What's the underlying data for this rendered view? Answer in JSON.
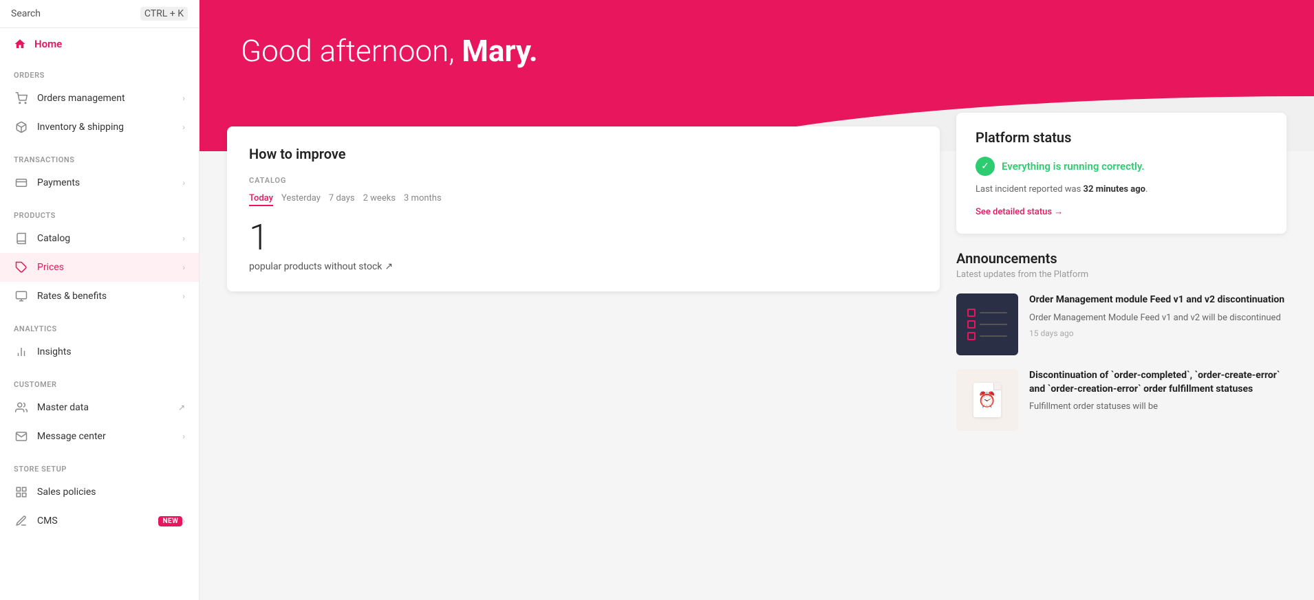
{
  "sidebar": {
    "search": {
      "label": "Search",
      "shortcut": "CTRL + K"
    },
    "home": {
      "label": "Home",
      "icon": "home-icon"
    },
    "sections": [
      {
        "label": "ORDERS",
        "items": [
          {
            "id": "orders-management",
            "label": "Orders management",
            "icon": "cart-icon",
            "hasChevron": true
          },
          {
            "id": "inventory-shipping",
            "label": "Inventory & shipping",
            "icon": "box-icon",
            "hasChevron": true
          }
        ]
      },
      {
        "label": "TRANSACTIONS",
        "items": [
          {
            "id": "payments",
            "label": "Payments",
            "icon": "payments-icon",
            "hasChevron": true
          }
        ]
      },
      {
        "label": "PRODUCTS",
        "items": [
          {
            "id": "catalog",
            "label": "Catalog",
            "icon": "catalog-icon",
            "hasChevron": true
          },
          {
            "id": "prices",
            "label": "Prices",
            "icon": "prices-icon",
            "hasChevron": true,
            "active": true
          },
          {
            "id": "rates-benefits",
            "label": "Rates & benefits",
            "icon": "rates-icon",
            "hasChevron": true
          }
        ]
      },
      {
        "label": "ANALYTICS",
        "items": [
          {
            "id": "insights",
            "label": "Insights",
            "icon": "insights-icon",
            "hasChevron": false
          }
        ]
      },
      {
        "label": "CUSTOMER",
        "items": [
          {
            "id": "master-data",
            "label": "Master data",
            "icon": "master-data-icon",
            "hasChevron": false,
            "external": true
          },
          {
            "id": "message-center",
            "label": "Message center",
            "icon": "message-icon",
            "hasChevron": true
          }
        ]
      },
      {
        "label": "STORE SETUP",
        "items": [
          {
            "id": "sales-policies",
            "label": "Sales policies",
            "icon": "sales-icon",
            "hasChevron": false
          },
          {
            "id": "cms",
            "label": "CMS",
            "icon": "cms-icon",
            "hasChevron": true,
            "badge": "NEW"
          }
        ]
      }
    ]
  },
  "hero": {
    "greeting": "Good afternoon, ",
    "name": "Mary."
  },
  "improve_card": {
    "title": "How to improve",
    "catalog_label": "CATALOG",
    "time_tabs": [
      "Today",
      "Yesterday",
      "7 days",
      "2 weeks",
      "3 months"
    ],
    "active_tab": "Today",
    "metric_number": "1",
    "metric_desc": "popular products without stock",
    "metric_arrow": "↗"
  },
  "platform_status": {
    "title": "Platform status",
    "ok_text": "Everything is running correctly.",
    "sub_text_prefix": "Last incident reported was ",
    "sub_text_time": "32 minutes ago",
    "sub_text_suffix": ".",
    "link_text": "See detailed status →"
  },
  "announcements": {
    "title": "Announcements",
    "subtitle": "Latest updates from the Platform",
    "items": [
      {
        "id": "ann-1",
        "headline": "Order Management module Feed v1 and v2 discontinuation",
        "text": "Order Management Module Feed v1 and v2 will be discontinued",
        "date": "15 days ago",
        "thumb_type": "dark"
      },
      {
        "id": "ann-2",
        "headline": "Discontinuation of `order-completed`, `order-create-error` and `order-creation-error` order fulfillment statuses",
        "text": "Fulfillment order statuses will be",
        "date": "",
        "thumb_type": "light"
      }
    ]
  },
  "colors": {
    "brand": "#e8175d",
    "success": "#2ecc71",
    "text_primary": "#222",
    "text_secondary": "#666",
    "text_muted": "#999"
  }
}
